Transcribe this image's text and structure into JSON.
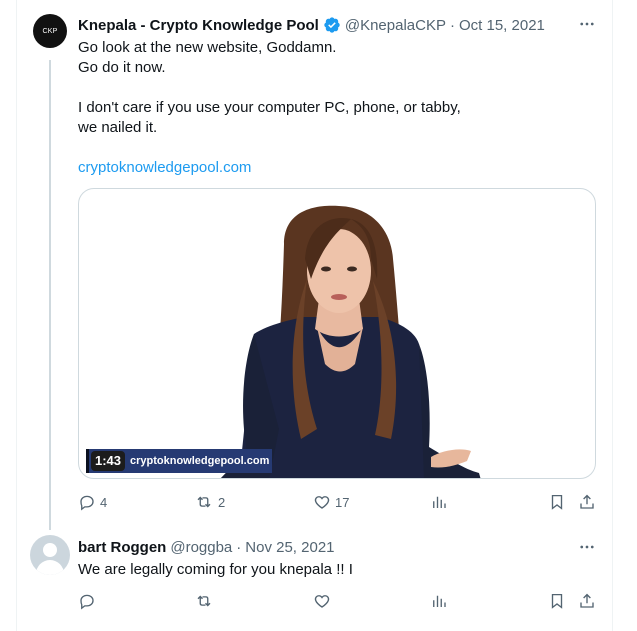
{
  "tweet": {
    "avatar_text": "CKP",
    "author_name": "Knepala - Crypto Knowledge Pool",
    "handle": "@KnepalaCKP",
    "separator": "·",
    "date": "Oct 15, 2021",
    "text_lines": [
      "Go look at the new website, Goddamn.",
      "Go do it now.",
      "",
      "I don't care if you use your computer PC, phone, or tabby,",
      "we nailed it.",
      ""
    ],
    "link": "cryptoknowledgepool.com",
    "media": {
      "duration": "1:43",
      "banner_text": "cryptoknowledgepool.com"
    },
    "actions": {
      "replies": "4",
      "reposts": "2",
      "likes": "17"
    }
  },
  "reply": {
    "author_name": "bart Roggen",
    "handle": "@roggba",
    "separator": "·",
    "date": "Nov 25, 2021",
    "text": "We are legally coming for you knepala !!  I"
  },
  "colors": {
    "accent": "#1d9bf0",
    "text": "#0f1419",
    "muted": "#536471",
    "border": "#cfd9de",
    "banner": "#263a73"
  },
  "icons": [
    "verified-badge-icon",
    "more-icon",
    "reply-icon",
    "repost-icon",
    "like-icon",
    "views-icon",
    "bookmark-icon",
    "share-icon"
  ]
}
